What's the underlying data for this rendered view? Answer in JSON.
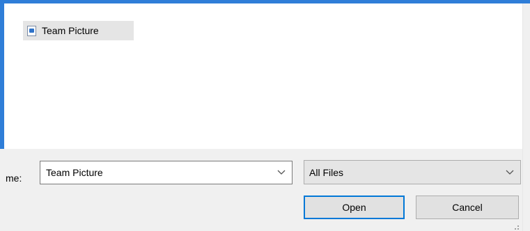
{
  "files": [
    {
      "label": "Team Picture",
      "icon": "image-file-icon"
    }
  ],
  "filename": {
    "label": "me:",
    "value": "Team Picture"
  },
  "filetype": {
    "selected": "All Files"
  },
  "buttons": {
    "open": "Open",
    "cancel": "Cancel"
  },
  "colors": {
    "frame": "#2f7ed8",
    "footer_bg": "#f0f0f0",
    "selection_bg": "#e5e5e5",
    "focus_border": "#0078d7"
  }
}
